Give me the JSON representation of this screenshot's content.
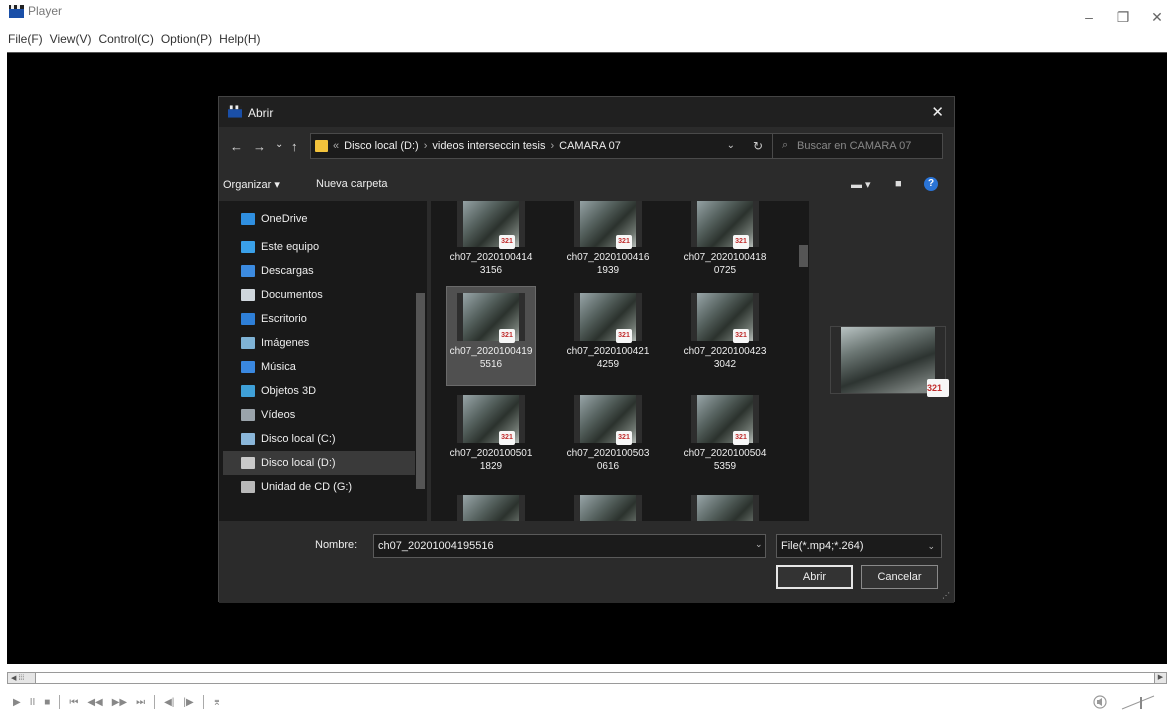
{
  "player": {
    "title": "Player",
    "menu": [
      "File(F)",
      "View(V)",
      "Control(C)",
      "Option(P)",
      "Help(H)"
    ],
    "window_buttons": {
      "minimize": "–",
      "restore": "❐",
      "close": "✕"
    },
    "controls": [
      "▶",
      "II",
      "■",
      "⏮",
      "◀◀",
      "▶▶",
      "⏭",
      "◀|",
      "|▶",
      "⌆"
    ],
    "seek_thumb": "◀ ⁞⁞⁞",
    "seek_end": "▶"
  },
  "dialog": {
    "title": "Abrir",
    "close": "✕",
    "nav": {
      "back": "←",
      "forward": "→",
      "recent": "⌄",
      "up": "↑"
    },
    "breadcrumb": [
      "«",
      "Disco local (D:)",
      "›",
      "videos interseccin tesis",
      "›",
      "CAMARA 07"
    ],
    "search_placeholder": "Buscar en CAMARA 07",
    "toolbar": {
      "organize": "Organizar ▾",
      "new_folder": "Nueva carpeta"
    },
    "nav_items": [
      {
        "label": "OneDrive",
        "icon": "cloud-icon",
        "color": "#2f8fe0"
      },
      {
        "label": "Este equipo",
        "icon": "computer-icon",
        "color": "#3aa0e8"
      },
      {
        "label": "Descargas",
        "icon": "download-icon",
        "color": "#3c8be0"
      },
      {
        "label": "Documentos",
        "icon": "document-icon",
        "color": "#cfd6dc"
      },
      {
        "label": "Escritorio",
        "icon": "desktop-icon",
        "color": "#2e7fd8"
      },
      {
        "label": "Imágenes",
        "icon": "pictures-icon",
        "color": "#7fb3d6"
      },
      {
        "label": "Música",
        "icon": "music-icon",
        "color": "#3a88e0"
      },
      {
        "label": "Objetos 3D",
        "icon": "cube-icon",
        "color": "#3fa0d8"
      },
      {
        "label": "Vídeos",
        "icon": "video-icon",
        "color": "#9aa3aa"
      },
      {
        "label": "Disco local (C:)",
        "icon": "drive-icon",
        "color": "#8ab6d9"
      },
      {
        "label": "Disco local (D:)",
        "icon": "drive-icon",
        "color": "#c9c9c9",
        "selected": true
      },
      {
        "label": "Unidad de CD (G:)",
        "icon": "cd-drive-icon",
        "color": "#b9b9b9"
      }
    ],
    "files": [
      {
        "line1": "ch07_2020100414",
        "line2": "3156"
      },
      {
        "line1": "ch07_2020100416",
        "line2": "1939"
      },
      {
        "line1": "ch07_2020100418",
        "line2": "0725"
      },
      {
        "line1": "ch07_2020100419",
        "line2": "5516",
        "selected": true
      },
      {
        "line1": "ch07_2020100421",
        "line2": "4259"
      },
      {
        "line1": "ch07_2020100423",
        "line2": "3042"
      },
      {
        "line1": "ch07_2020100501",
        "line2": "1829"
      },
      {
        "line1": "ch07_2020100503",
        "line2": "0616"
      },
      {
        "line1": "ch07_2020100504",
        "line2": "5359"
      }
    ],
    "badge_text": "321",
    "name_label": "Nombre:",
    "name_value": "ch07_20201004195516",
    "file_type": "File(*.mp4;*.264)",
    "open_button": "Abrir",
    "cancel_button": "Cancelar"
  }
}
